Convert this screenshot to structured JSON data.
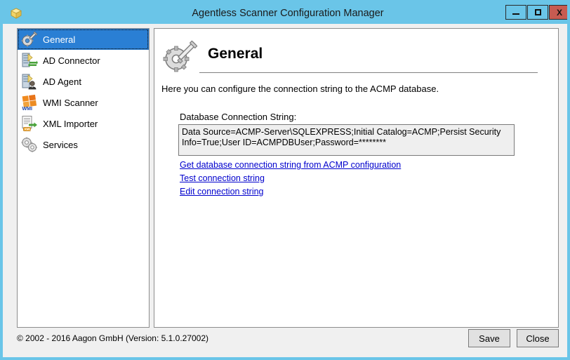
{
  "window": {
    "title": "Agentless Scanner Configuration Manager",
    "app_icon": "shield-box-icon",
    "controls": {
      "minimize_label": "Minimize",
      "maximize_label": "Maximize",
      "close_label": "X"
    },
    "colors": {
      "titlebar": "#6ac5e8",
      "close_button": "#c75b51",
      "selection": "#2a7fd4",
      "link": "#0000cd",
      "panel_background": "#ffffff",
      "client_background": "#f0f0f0",
      "textbox_background": "#efefef"
    }
  },
  "sidebar": {
    "items": [
      {
        "label": "General",
        "icon": "gear-wrench-icon",
        "selected": true
      },
      {
        "label": "AD Connector",
        "icon": "server-sync-icon",
        "selected": false
      },
      {
        "label": "AD Agent",
        "icon": "server-user-icon",
        "selected": false
      },
      {
        "label": "WMI Scanner",
        "icon": "windows-wmi-icon",
        "selected": false
      },
      {
        "label": "XML Importer",
        "icon": "document-xml-arrow-icon",
        "selected": false
      },
      {
        "label": "Services",
        "icon": "двух-gears-icon",
        "selected": false
      }
    ]
  },
  "panel": {
    "icon": "gear-wrench-large-icon",
    "title": "General",
    "description": "Here you can configure the connection string to the ACMP database.",
    "field_label": "Database Connection String:",
    "connection_string": "Data Source=ACMP-Server\\SQLEXPRESS;Initial Catalog=ACMP;Persist Security Info=True;User ID=ACMPDBUser;Password=********",
    "links": [
      "Get database connection string from ACMP configuration",
      "Test connection string",
      "Edit connection string"
    ]
  },
  "footer": {
    "copyright": "© 2002 - 2016 Aagon GmbH (Version: 5.1.0.27002)",
    "buttons": [
      {
        "label": "Save"
      },
      {
        "label": "Close"
      }
    ]
  }
}
